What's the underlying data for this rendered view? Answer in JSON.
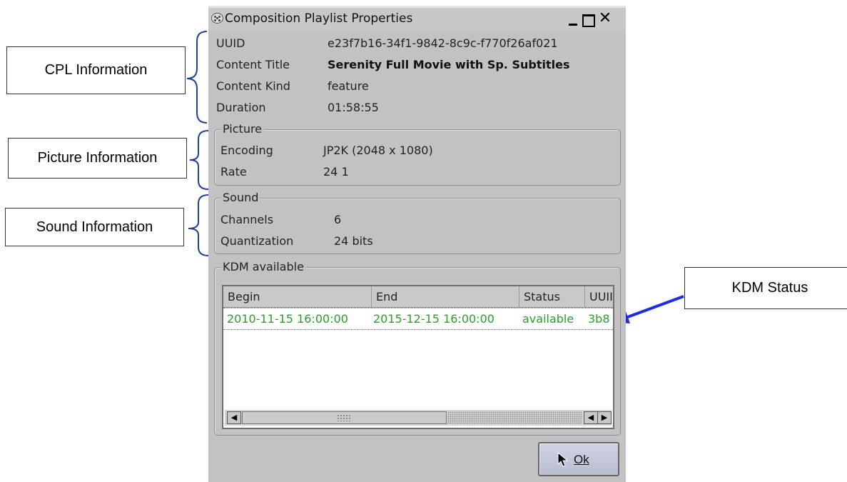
{
  "window": {
    "title": "Composition Playlist Properties"
  },
  "cpl": {
    "uuid_label": "UUID",
    "uuid_value": "e23f7b16-34f1-9842-8c9c-f770f26af021",
    "content_title_label": "Content Title",
    "content_title_value": "Serenity Full Movie with Sp. Subtitles",
    "content_kind_label": "Content Kind",
    "content_kind_value": "feature",
    "duration_label": "Duration",
    "duration_value": "01:58:55"
  },
  "picture": {
    "group_title": "Picture",
    "encoding_label": "Encoding",
    "encoding_value": "JP2K (2048 x 1080)",
    "rate_label": "Rate",
    "rate_value": "24 1"
  },
  "sound": {
    "group_title": "Sound",
    "channels_label": "Channels",
    "channels_value": "6",
    "quantization_label": "Quantization",
    "quantization_value": "24 bits"
  },
  "kdm": {
    "group_title": "KDM available",
    "columns": [
      "Begin",
      "End",
      "Status",
      "UUII"
    ],
    "rows": [
      {
        "begin": "2010-11-15 16:00:00",
        "end": "2015-12-15 16:00:00",
        "status": "available",
        "uuid": "3b8"
      }
    ]
  },
  "buttons": {
    "ok_label": "Ok"
  },
  "annotations": {
    "cpl": "CPL Information",
    "picture": "Picture Information",
    "sound": "Sound Information",
    "kdm": "KDM Status"
  },
  "colors": {
    "row_text": "#28a028",
    "arrow": "#1a2ee0",
    "bracket": "#1f3f9f"
  },
  "icons": [
    "film-reel-icon",
    "minimize-icon",
    "maximize-icon",
    "close-icon",
    "scroll-left-icon",
    "scroll-right-icon",
    "mouse-pointer-icon",
    "arrow-icon"
  ]
}
